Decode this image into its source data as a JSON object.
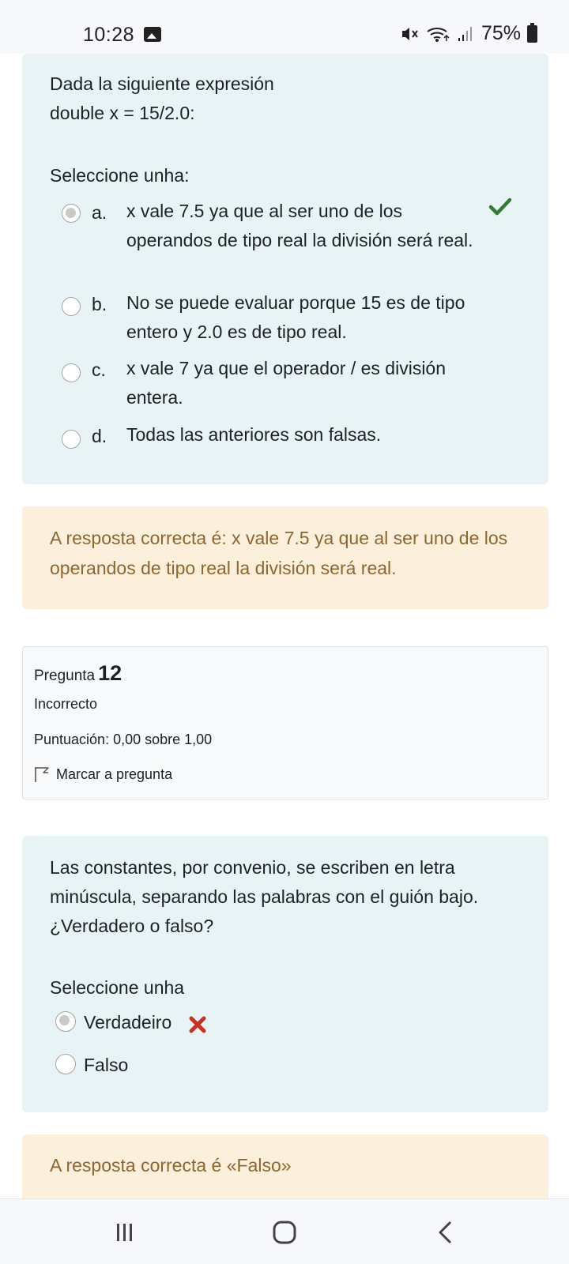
{
  "status": {
    "time": "10:28",
    "battery": "75%"
  },
  "q11": {
    "text_line1": "Dada la siguiente expresión",
    "text_line2": "double x = 15/2.0:",
    "select_prompt": "Seleccione unha:",
    "options": [
      {
        "letter": "a.",
        "text": "x vale 7.5 ya que al ser uno de los operandos de tipo real la división será real.",
        "selected": true,
        "result_icon": "checkmark-icon"
      },
      {
        "letter": "b.",
        "text": "No se puede evaluar porque 15 es de tipo entero y 2.0 es de tipo real.",
        "selected": false
      },
      {
        "letter": "c.",
        "text": "x vale 7 ya que el operador / es división entera.",
        "selected": false
      },
      {
        "letter": "d.",
        "text": "Todas las anteriores son falsas.",
        "selected": false
      }
    ],
    "feedback": "A resposta correcta é: x vale 7.5 ya que al ser uno de los operandos de tipo real la división será real."
  },
  "q12": {
    "label": "Pregunta",
    "number": "12",
    "state": "Incorrecto",
    "grade": "Puntuación: 0,00 sobre 1,00",
    "flag_label": "Marcar a pregunta",
    "text": "Las constantes, por convenio, se escriben en letra minúscula, separando las palabras con el guión bajo. ¿Verdadero o falso?",
    "select_prompt": "Seleccione unha",
    "options": [
      {
        "text": "Verdadeiro",
        "selected": true,
        "result_icon": "cross-icon"
      },
      {
        "text": "Falso",
        "selected": false
      }
    ],
    "feedback": "A resposta correcta é «Falso»"
  },
  "colors": {
    "info_bg": "#e7f3f5",
    "feedback_bg": "#fcefdc",
    "feedback_text": "#8e662e",
    "correct": "#357a32",
    "incorrect": "#ca3120"
  }
}
